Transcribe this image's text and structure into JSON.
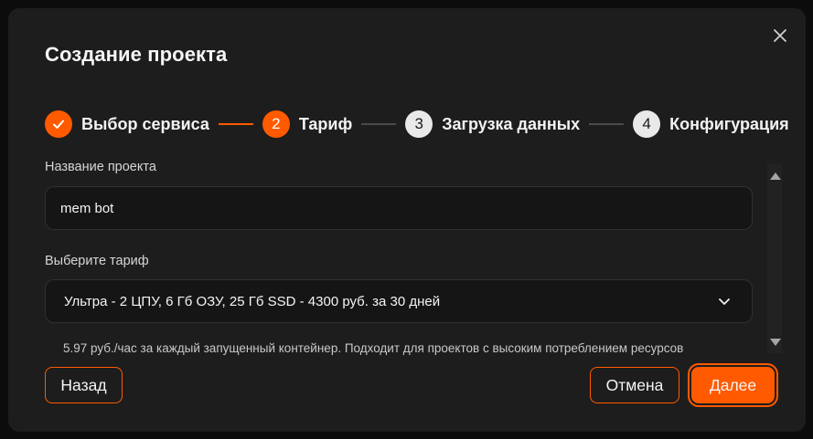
{
  "dialog": {
    "title": "Создание проекта",
    "close_label": "×"
  },
  "stepper": {
    "steps": [
      {
        "number": "1",
        "label": "Выбор сервиса",
        "state": "done"
      },
      {
        "number": "2",
        "label": "Тариф",
        "state": "active"
      },
      {
        "number": "3",
        "label": "Загрузка данных",
        "state": "pending"
      },
      {
        "number": "4",
        "label": "Конфигурация",
        "state": "pending"
      }
    ]
  },
  "form": {
    "project_name": {
      "label": "Название проекта",
      "value": "mem bot"
    },
    "tariff": {
      "label": "Выберите тариф",
      "selected": "Ультра - 2 ЦПУ, 6 Гб ОЗУ, 25 Гб SSD - 4300 руб. за 30 дней",
      "hint": "5.97 руб./час за каждый запущенный контейнер. Подходит для проектов с высоким потреблением ресурсов"
    }
  },
  "footer": {
    "back_label": "Назад",
    "cancel_label": "Отмена",
    "next_label": "Далее"
  },
  "colors": {
    "accent": "#ff5a00",
    "background": "#1d1d1d",
    "field_background": "#151515"
  },
  "icons": {
    "close": "close-icon",
    "check": "check-icon",
    "chevron": "chevron-down-icon",
    "scroll_up": "arrow-up-icon",
    "scroll_down": "arrow-down-icon"
  }
}
